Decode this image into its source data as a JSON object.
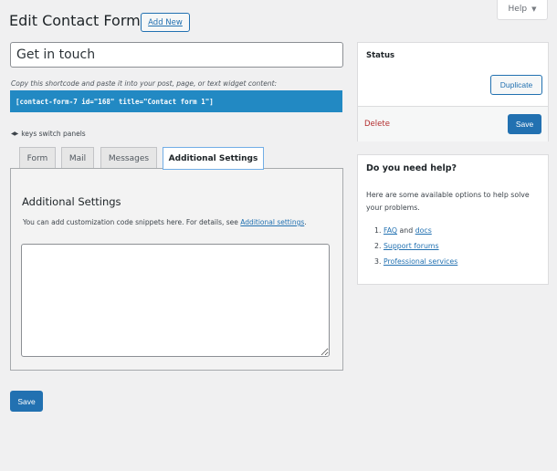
{
  "header": {
    "title": "Edit Contact Form",
    "add_new_label": "Add New",
    "help_label": "Help",
    "help_arrow": "▼"
  },
  "form": {
    "title_value": "Get in touch",
    "title_placeholder": "",
    "shortcode_hint": "Copy this shortcode and paste it into your post, page, or text widget content:",
    "shortcode": "[contact-form-7 id=\"168\" title=\"Contact form 1\"]",
    "keys_icon": "◀▶",
    "keys_hint": "keys switch panels"
  },
  "tabs": [
    {
      "label": "Form",
      "active": false
    },
    {
      "label": "Mail",
      "active": false
    },
    {
      "label": "Messages",
      "active": false
    },
    {
      "label": "Additional Settings",
      "active": true
    }
  ],
  "panel": {
    "title": "Additional Settings",
    "desc_before": "You can add customization code snippets here. For details, see ",
    "desc_link": "Additional settings",
    "desc_after": ".",
    "textarea_value": ""
  },
  "save_label": "Save",
  "sidebar": {
    "status": {
      "title": "Status",
      "duplicate_label": "Duplicate",
      "delete_label": "Delete",
      "save_label": "Save"
    },
    "help": {
      "title": "Do you need help?",
      "desc": "Here are some available options to help solve your problems.",
      "items": [
        {
          "num": "1.",
          "link1": "FAQ",
          "mid": " and ",
          "link2": "docs"
        },
        {
          "num": "2.",
          "link1": "Support forums"
        },
        {
          "num": "3.",
          "link1": "Professional services"
        }
      ]
    }
  },
  "colors": {
    "primary": "#2271b1",
    "shortcode_bg": "#2289c3",
    "delete": "#b32d2e",
    "background": "#f0f0f1"
  }
}
